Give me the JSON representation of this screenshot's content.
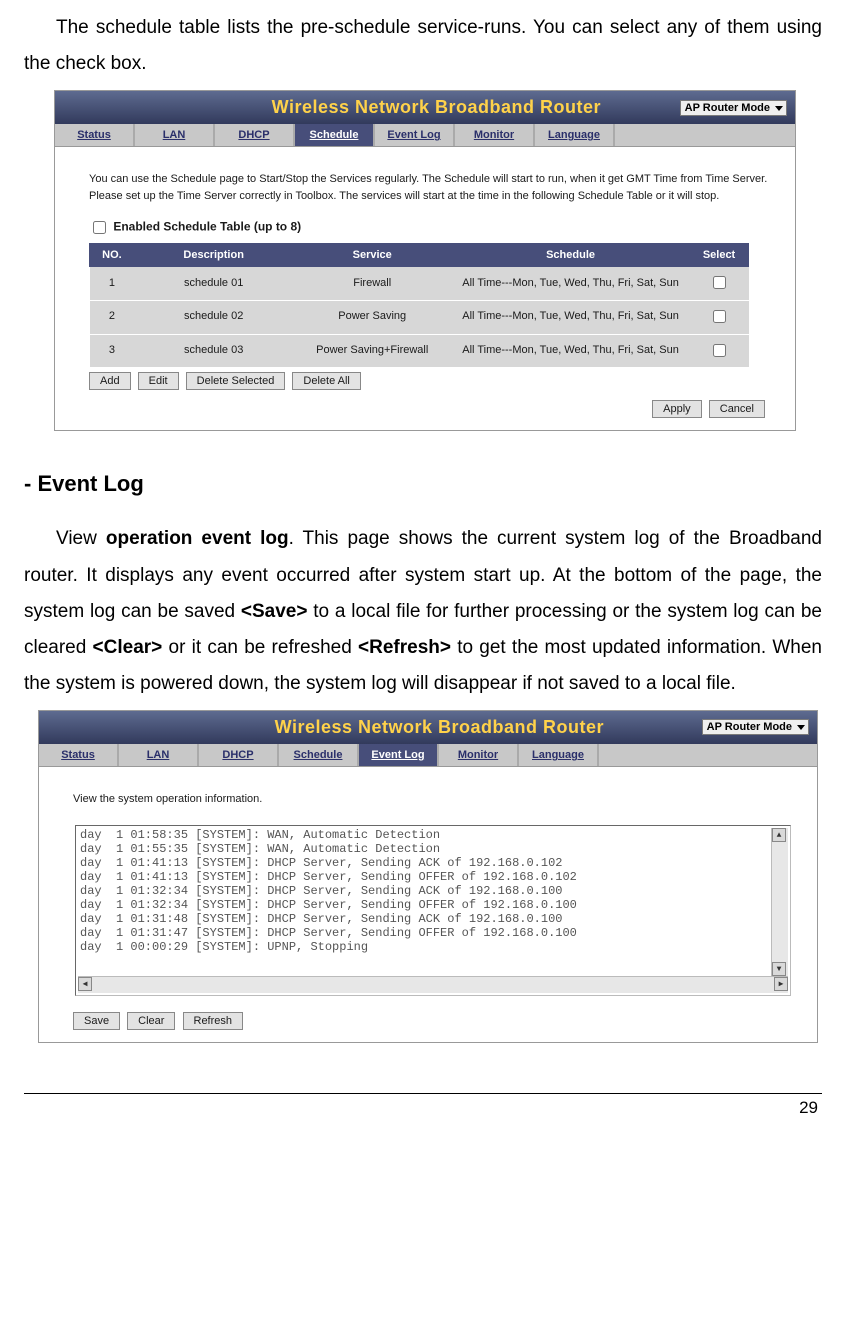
{
  "intro_text": "The schedule table lists the pre-schedule service-runs. You can select any of them using the check box.",
  "schedule_ss": {
    "title": "Wireless Network Broadband Router",
    "mode": "AP Router Mode",
    "nav": [
      "Status",
      "LAN",
      "DHCP",
      "Schedule",
      "Event Log",
      "Monitor",
      "Language"
    ],
    "active_tab": "Schedule",
    "desc": "You can use the Schedule page to Start/Stop the Services regularly. The Schedule will start to run, when it get GMT Time from Time Server. Please set up the Time Server correctly in Toolbox. The services will start at the time in the following Schedule Table or it will stop.",
    "enable_label": "Enabled Schedule Table (up to 8)",
    "cols": [
      "NO.",
      "Description",
      "Service",
      "Schedule",
      "Select"
    ],
    "rows": [
      {
        "no": "1",
        "desc": "schedule 01",
        "service": "Firewall",
        "schedule": "All Time---Mon, Tue, Wed, Thu, Fri, Sat, Sun"
      },
      {
        "no": "2",
        "desc": "schedule 02",
        "service": "Power Saving",
        "schedule": "All Time---Mon, Tue, Wed, Thu, Fri, Sat, Sun"
      },
      {
        "no": "3",
        "desc": "schedule 03",
        "service": "Power Saving+Firewall",
        "schedule": "All Time---Mon, Tue, Wed, Thu, Fri, Sat, Sun"
      }
    ],
    "buttons_left": [
      "Add",
      "Edit",
      "Delete Selected",
      "Delete All"
    ],
    "buttons_right": [
      "Apply",
      "Cancel"
    ]
  },
  "section_heading": "- Event Log",
  "event_log_par_prefix": "View ",
  "event_log_par_bold1": "operation event log",
  "event_log_par_mid1": ". This page shows the current system log of the Broadband router. It displays any event occurred after system start up. At the bottom of the page, the system log can be saved ",
  "event_log_par_bold2": "<Save>",
  "event_log_par_mid2": " to a local file for further processing or the system log can be cleared ",
  "event_log_par_bold3": "<Clear>",
  "event_log_par_mid3": " or it can be refreshed ",
  "event_log_par_bold4": "<Refresh>",
  "event_log_par_end": " to get the most updated information. When the system is powered down, the system log will disappear if not saved to a local file.",
  "eventlog_ss": {
    "title": "Wireless Network Broadband Router",
    "mode": "AP Router Mode",
    "nav": [
      "Status",
      "LAN",
      "DHCP",
      "Schedule",
      "Event Log",
      "Monitor",
      "Language"
    ],
    "active_tab": "Event Log",
    "desc": "View the system operation information.",
    "log": "day  1 01:58:35 [SYSTEM]: WAN, Automatic Detection\nday  1 01:55:35 [SYSTEM]: WAN, Automatic Detection\nday  1 01:41:13 [SYSTEM]: DHCP Server, Sending ACK of 192.168.0.102\nday  1 01:41:13 [SYSTEM]: DHCP Server, Sending OFFER of 192.168.0.102\nday  1 01:32:34 [SYSTEM]: DHCP Server, Sending ACK of 192.168.0.100\nday  1 01:32:34 [SYSTEM]: DHCP Server, Sending OFFER of 192.168.0.100\nday  1 01:31:48 [SYSTEM]: DHCP Server, Sending ACK of 192.168.0.100\nday  1 01:31:47 [SYSTEM]: DHCP Server, Sending OFFER of 192.168.0.100\nday  1 00:00:29 [SYSTEM]: UPNP, Stopping",
    "buttons": [
      "Save",
      "Clear",
      "Refresh"
    ]
  },
  "page_number": "29"
}
